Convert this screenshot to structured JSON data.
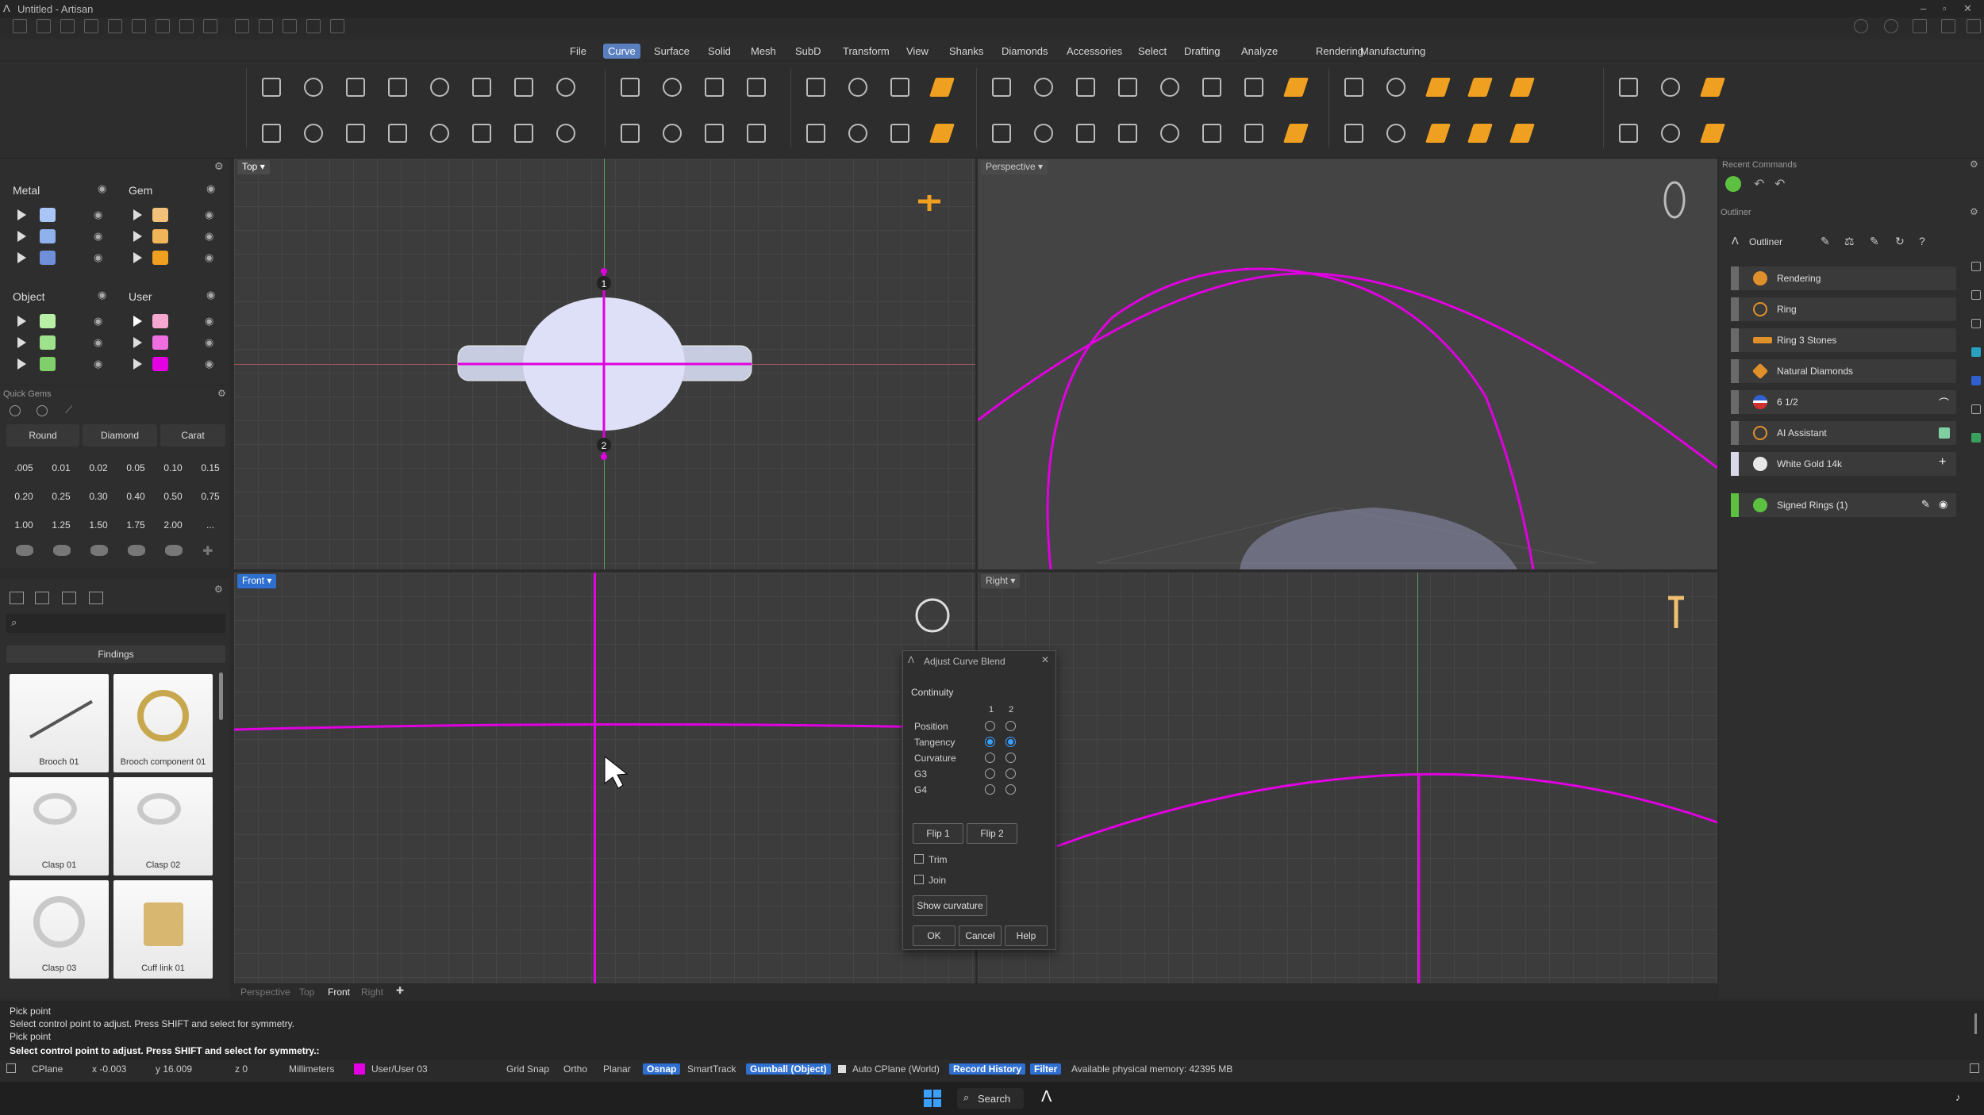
{
  "window": {
    "title": "Untitled - Artisan"
  },
  "menu": [
    "File",
    "Curve",
    "Surface",
    "Solid",
    "Mesh",
    "SubD",
    "Transform",
    "View",
    "Shanks",
    "Diamonds",
    "Accessories",
    "Select",
    "Drafting",
    "Analyze",
    "Rendering",
    "Manufacturing"
  ],
  "menu_active": "Curve",
  "layers": {
    "metal": {
      "title": "Metal",
      "colors": [
        "#a9c4f5",
        "#8fb1ec",
        "#6f8fd8"
      ]
    },
    "gem": {
      "title": "Gem",
      "colors": [
        "#f3c27a",
        "#f0b558",
        "#f0a020"
      ]
    },
    "object": {
      "title": "Object",
      "colors": [
        "#b8f0a8",
        "#9ee28c",
        "#7fd06a"
      ]
    },
    "user": {
      "title": "User",
      "colors": [
        "#f4a8d0",
        "#ef6fe0",
        "#e300e3"
      ]
    }
  },
  "quick_gems": {
    "title": "Quick Gems",
    "shape": "Round",
    "cut": "Diamond",
    "unit": "Carat",
    "values": [
      ".005",
      "0.01",
      "0.02",
      "0.05",
      "0.10",
      "0.15",
      "0.20",
      "0.25",
      "0.30",
      "0.40",
      "0.50",
      "0.75",
      "1.00",
      "1.25",
      "1.50",
      "1.75",
      "2.00",
      "..."
    ]
  },
  "library": {
    "category": "Findings",
    "items": [
      "Brooch 01",
      "Brooch component 01",
      "Clasp 01",
      "Clasp 02",
      "Clasp 03",
      "Cuff link 01"
    ]
  },
  "viewports": {
    "top": "Top",
    "perspective": "Perspective",
    "front": "Front",
    "right": "Right"
  },
  "viewport_tabs": [
    "Perspective",
    "Top",
    "Front",
    "Right"
  ],
  "point_labels": [
    "1",
    "2"
  ],
  "dialog": {
    "title": "Adjust Curve Blend",
    "section": "Continuity",
    "col1": "1",
    "col2": "2",
    "rows": [
      "Position",
      "Tangency",
      "Curvature",
      "G3",
      "G4"
    ],
    "selected": "Tangency",
    "flip1": "Flip 1",
    "flip2": "Flip 2",
    "trim": "Trim",
    "join": "Join",
    "show_curvature": "Show curvature",
    "ok": "OK",
    "cancel": "Cancel",
    "help": "Help"
  },
  "recent_commands": {
    "title": "Recent Commands"
  },
  "outliner": {
    "title": "Outliner",
    "panel": "Outliner",
    "items": [
      {
        "label": "Rendering",
        "color": "#e0902a"
      },
      {
        "label": "Ring",
        "color": "#e0902a"
      },
      {
        "label": "Ring 3 Stones",
        "color": "#e0902a"
      },
      {
        "label": "Natural Diamonds",
        "color": "#e0902a"
      },
      {
        "label": "6 1/2",
        "color": "#3060d0"
      },
      {
        "label": "AI Assistant",
        "color": "#e0902a"
      },
      {
        "label": "White Gold 14k",
        "color": "#d8d8d8"
      },
      {
        "label": "Signed Rings (1)",
        "color": "#5cc040"
      }
    ]
  },
  "command_lines": [
    "Pick point",
    "Select control point to adjust. Press SHIFT and select for symmetry.",
    "Pick point"
  ],
  "command_prompt": "Select control point to adjust. Press SHIFT and select for symmetry.:",
  "status": {
    "cplane": "CPlane",
    "x": "x -0.003",
    "y": "y 16.009",
    "z": "z 0",
    "units": "Millimeters",
    "layer": "User/User 03",
    "grid_snap": "Grid Snap",
    "ortho": "Ortho",
    "planar": "Planar",
    "osnap": "Osnap",
    "smarttrack": "SmartTrack",
    "gumball": "Gumball (Object)",
    "auto_cplane": "Auto CPlane (World)",
    "record_history": "Record History",
    "filter": "Filter",
    "memory": "Available physical memory: 42395 MB"
  },
  "taskbar": {
    "search": "Search"
  }
}
